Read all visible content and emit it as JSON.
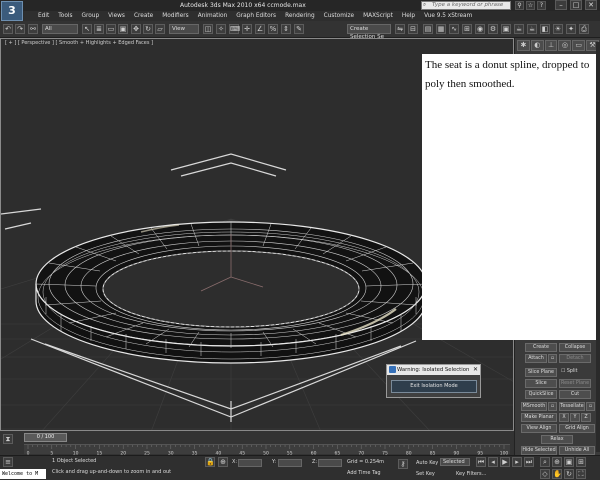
{
  "window": {
    "title": "Autodesk 3ds Max 2010 x64      ccmode.max",
    "search_placeholder": "Type a keyword or phrase",
    "logo": "3"
  },
  "menu": [
    "Edit",
    "Tools",
    "Group",
    "Views",
    "Create",
    "Modifiers",
    "Animation",
    "Graph Editors",
    "Rendering",
    "Customize",
    "MAXScript",
    "Help",
    "Vue 9.5 xStream"
  ],
  "toolbar": {
    "selection_filter": "All",
    "ref_coord": "View",
    "named_selection": "Create Selection Se"
  },
  "viewport": {
    "label": "[ + ] [ Perspective ] [ Smooth + Highlights + Edged Faces ]"
  },
  "note": {
    "text": "The seat is a donut spline, dropped to poly then smoothed."
  },
  "command_panel": {
    "buttons": {
      "create": "Create",
      "collapse": "Collapse",
      "attach": "Attach",
      "detach": "Detach",
      "slice_plane": "Slice Plane",
      "split": "Split",
      "slice": "Slice",
      "reset_plane": "Reset Plane",
      "quickslice": "QuickSlice",
      "cut": "Cut",
      "msmooth": "MSmooth",
      "tessellate": "Tessellate",
      "make_planar": "Make Planar",
      "x": "X",
      "y": "Y",
      "z": "Z",
      "view_align": "View Align",
      "grid_align": "Grid Align",
      "relax": "Relax",
      "hide_selected": "Hide Selected",
      "unhide_all": "Unhide All"
    }
  },
  "warning": {
    "title": "Warning: Isolated Selection",
    "button": "Exit Isolation Mode",
    "close": "✕"
  },
  "timeline": {
    "frame": "0 / 100",
    "ticks": [
      "0",
      "5",
      "10",
      "15",
      "20",
      "25",
      "30",
      "35",
      "40",
      "45",
      "50",
      "55",
      "60",
      "65",
      "70",
      "75",
      "80",
      "85",
      "90",
      "95",
      "100"
    ]
  },
  "status": {
    "maxscript": "Welcome to M",
    "selected": "1 Object Selected",
    "prompt": "Click and drag up-and-down to zoom in and out",
    "x_label": "X:",
    "y_label": "Y:",
    "z_label": "Z:",
    "grid": "Grid = 0.254m",
    "add_time_tag": "Add Time Tag",
    "auto_key": "Auto Key",
    "set_key": "Set Key",
    "selected_dd": "Selected",
    "key_filters": "Key Filters..."
  }
}
